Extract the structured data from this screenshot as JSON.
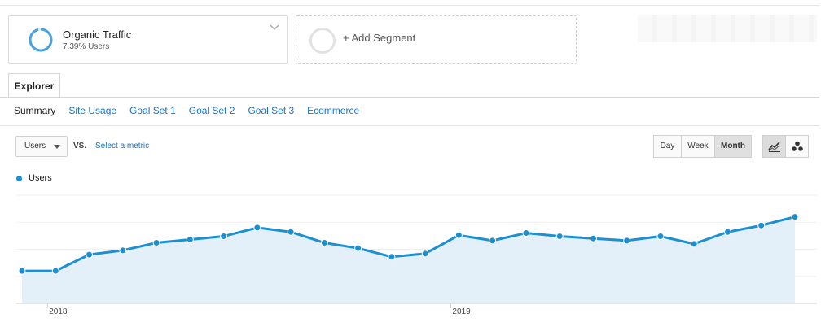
{
  "segment": {
    "title": "Organic Traffic",
    "subtitle": "7.39% Users",
    "ring_color": "#4aa3df"
  },
  "add_segment": {
    "label": "+ Add Segment"
  },
  "tabs": {
    "active": "Explorer"
  },
  "subtabs": [
    {
      "label": "Summary",
      "active": true
    },
    {
      "label": "Site Usage",
      "active": false
    },
    {
      "label": "Goal Set 1",
      "active": false
    },
    {
      "label": "Goal Set 2",
      "active": false
    },
    {
      "label": "Goal Set 3",
      "active": false
    },
    {
      "label": "Ecommerce",
      "active": false
    }
  ],
  "controls": {
    "metric": "Users",
    "vs": "VS.",
    "select_metric": "Select a metric",
    "periods": [
      {
        "label": "Day",
        "active": false
      },
      {
        "label": "Week",
        "active": false
      },
      {
        "label": "Month",
        "active": true
      }
    ],
    "chart_types": [
      {
        "icon": "line-chart-icon",
        "active": true
      },
      {
        "icon": "motion-chart-icon",
        "active": false
      }
    ]
  },
  "legend": {
    "label": "Users",
    "color": "#1b8fd1"
  },
  "chart_data": {
    "type": "area",
    "series": [
      {
        "name": "Users",
        "color": "#1b8fd1",
        "values": [
          30,
          30,
          45,
          49,
          56,
          59,
          62,
          70,
          66,
          56,
          51,
          43,
          46,
          63,
          58,
          65,
          62,
          60,
          58,
          62,
          55,
          66,
          72,
          80
        ]
      }
    ],
    "x_tick_labels": [
      {
        "label": "2018",
        "index": 1
      },
      {
        "label": "2019",
        "index": 13
      }
    ],
    "ylim": [
      0,
      100
    ],
    "grid": true,
    "fill_color": "#e3f0fa"
  }
}
